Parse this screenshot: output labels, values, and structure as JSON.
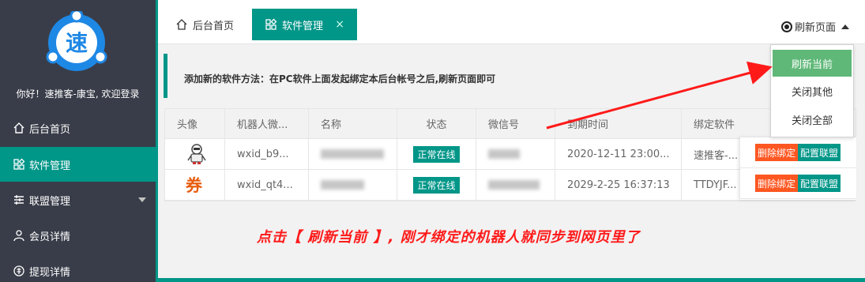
{
  "sidebar": {
    "logo_char": "速",
    "welcome": "你好！速推客-康宝, 欢迎登录",
    "items": [
      {
        "label": "后台首页",
        "icon": "home-icon"
      },
      {
        "label": "软件管理",
        "icon": "app-icon",
        "active": true
      },
      {
        "label": "联盟管理",
        "icon": "list-icon",
        "has_arrow": true
      },
      {
        "label": "会员详情",
        "icon": "user-icon"
      },
      {
        "label": "提现详情",
        "icon": "withdraw-icon"
      }
    ]
  },
  "tabs": [
    {
      "label": "后台首页",
      "icon": "home-icon"
    },
    {
      "label": "软件管理",
      "icon": "app-icon",
      "active": true,
      "close": "×"
    }
  ],
  "refresh_menu": {
    "label": "刷新页面",
    "items": [
      "刷新当前",
      "关闭其他",
      "关闭全部"
    ]
  },
  "notice": "添加新的软件方法：在PC软件上面发起绑定本后台帐号之后,刷新页面即可",
  "table": {
    "headers": [
      "头像",
      "机器人微...",
      "名称",
      "状态",
      "微信号",
      "到期时间",
      "绑定软件"
    ],
    "rows": [
      {
        "avatar": "robot",
        "robot_wx": "wxid_b9...",
        "status": "正常在线",
        "expire": "2020-12-11 23:00...",
        "software": "速推客-..."
      },
      {
        "avatar": "券",
        "robot_wx": "wxid_qt4...",
        "status": "正常在线",
        "expire": "2029-2-25 16:37:13",
        "software": "TTDYJF..."
      }
    ],
    "actions": {
      "delete": "删除绑定",
      "config": "配置联盟"
    }
  },
  "annotation": "点击【 刷新当前 】, 刚才绑定的机器人就同步到网页里了",
  "colors": {
    "teal": "#009688",
    "sidebar": "#393d49",
    "delete": "#ff5722",
    "dropdown_active": "#5fb878",
    "annotation": "#ff1a1a"
  }
}
